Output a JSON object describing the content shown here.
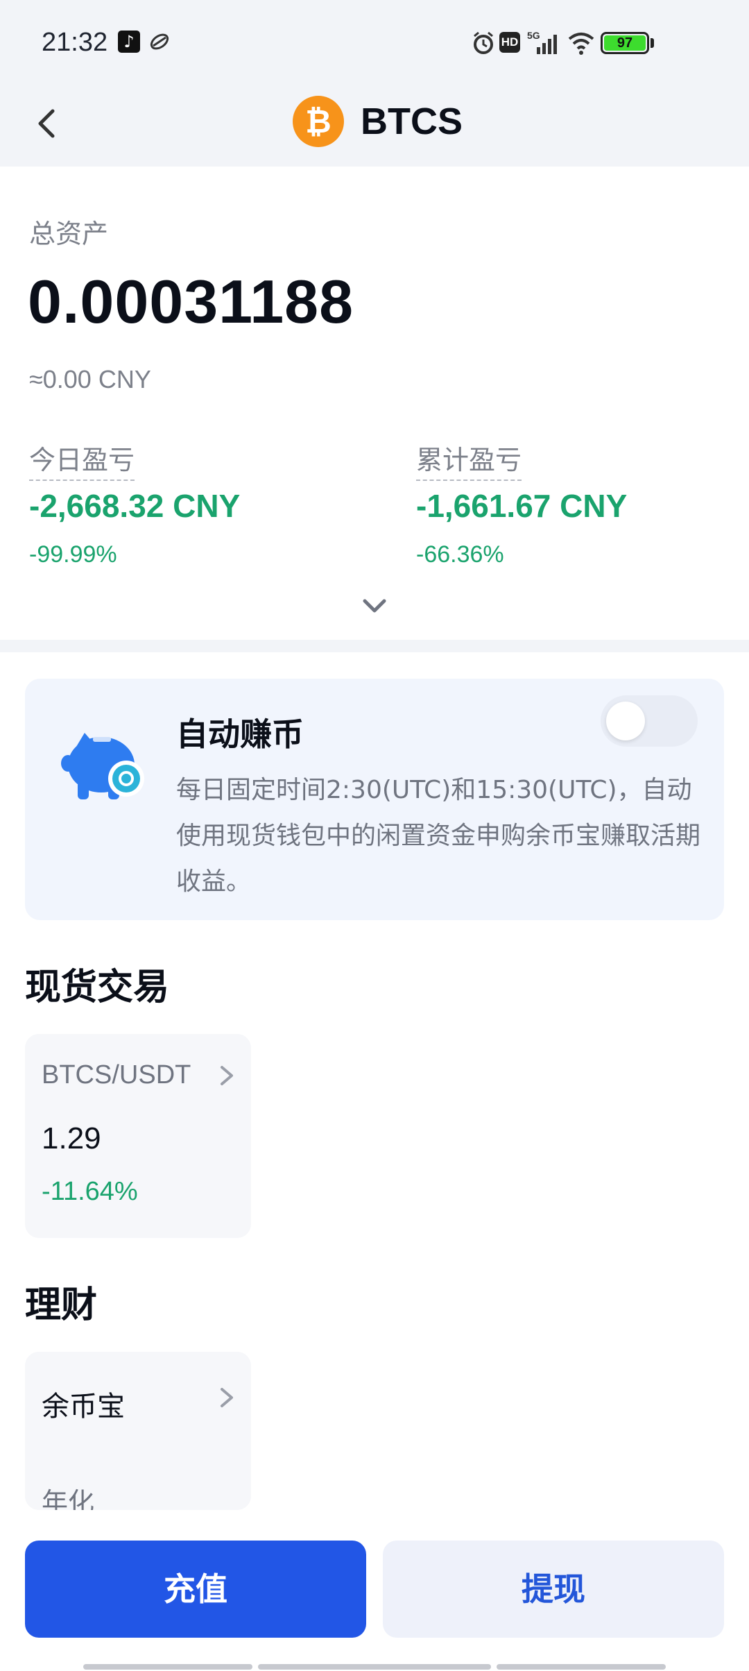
{
  "status_bar": {
    "time": "21:32",
    "battery": "97",
    "network": "5G",
    "hd_badge": "HD",
    "icons": [
      "tiktok-icon",
      "app-icon",
      "alarm-icon",
      "hd-icon",
      "signal-5g-icon",
      "wifi-icon",
      "battery-icon"
    ],
    "battery_color": "#3ddc2e"
  },
  "header": {
    "title": "BTCS",
    "coin_glyph": "₿",
    "coin_color": "#f7931a",
    "back_icon": "chevron-left-icon"
  },
  "assets": {
    "label": "总资产",
    "value": "0.00031188",
    "fiat": "≈0.00 CNY"
  },
  "pnl": {
    "today": {
      "label": "今日盈亏",
      "value": "-2,668.32 CNY",
      "percent": "-99.99%"
    },
    "total": {
      "label": "累计盈亏",
      "value": "-1,661.67 CNY",
      "percent": "-66.36%"
    },
    "negative_color": "#1aa36d",
    "expand_icon": "chevron-down-icon"
  },
  "auto_earn": {
    "title": "自动赚币",
    "description": "每日固定时间2:30(UTC)和15:30(UTC)，自动使用现货钱包中的闲置资金申购余币宝赚取活期收益。",
    "toggle_on": false,
    "icon": "piggy-bank-icon"
  },
  "spot": {
    "section_title": "现货交易",
    "pair": "BTCS/USDT",
    "price": "1.29",
    "change": "-11.64%"
  },
  "finance": {
    "section_title": "理财",
    "product": "余币宝",
    "sub_label": "年化"
  },
  "actions": {
    "deposit": "充值",
    "withdraw": "提现",
    "primary_color": "#2256e6"
  }
}
